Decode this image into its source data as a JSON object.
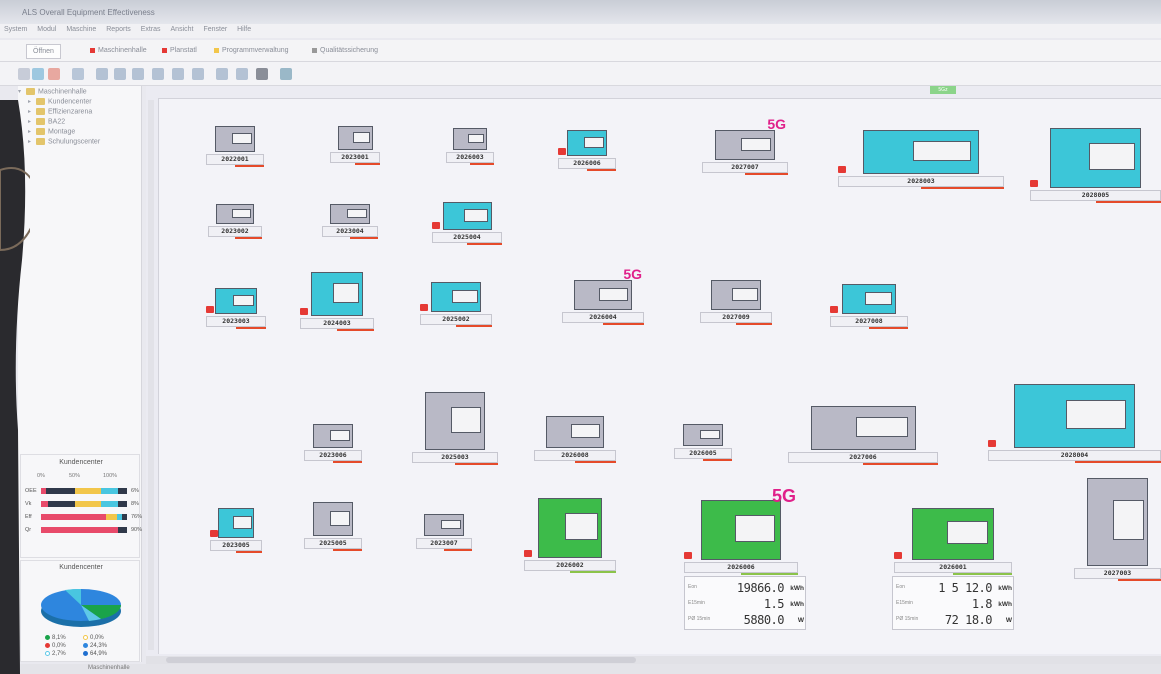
{
  "window": {
    "title": "ALS Overall Equipment Effectiveness"
  },
  "menu": [
    "System",
    "Modul",
    "Maschine",
    "Reports",
    "Extras",
    "Ansicht",
    "Fenster",
    "Hilfe"
  ],
  "tabs": [
    {
      "label": "Öffnen"
    },
    {
      "label": "Maschinenhalle",
      "color": "#e53935"
    },
    {
      "label": "Planstatl",
      "color": "#e53935"
    },
    {
      "label": "Programmverwaltung",
      "color": "#f2c64a"
    },
    {
      "label": "Qualitätssicherung",
      "color": "#999999"
    }
  ],
  "tree": {
    "root": "Maschinenhalle",
    "children": [
      "Kundencenter",
      "Effizienzarena",
      "BA22",
      "Montage",
      "Schulungscenter"
    ]
  },
  "kpi": {
    "title": "Kundencenter",
    "scale": [
      "0%",
      "50%",
      "100%"
    ],
    "rows": [
      {
        "label": "OEE",
        "value": "6%",
        "fill": 0.06
      },
      {
        "label": "Vk",
        "value": "8%",
        "fill": 0.08
      },
      {
        "label": "Eff",
        "value": "76%",
        "fill": 0.76
      },
      {
        "label": "Qr",
        "value": "90%",
        "fill": 0.9
      }
    ]
  },
  "pie": {
    "title": "Kundencenter",
    "legend": [
      {
        "text": "8,1%",
        "color": "#1aa34a"
      },
      {
        "text": "0,0%",
        "color": "#f2c64a"
      },
      {
        "text": "0,0%",
        "color": "#e53935"
      },
      {
        "text": "24,3%",
        "color": "#2e86de"
      },
      {
        "text": "2,7%",
        "color": "#5ec8e8"
      },
      {
        "text": "64,9%",
        "color": "#1f6fd0"
      }
    ]
  },
  "canvas_tag": "5Gz",
  "machines": [
    {
      "id": "2022001",
      "color": "#b9b9c6"
    },
    {
      "id": "2023001",
      "color": "#b9b9c6"
    },
    {
      "id": "2026003",
      "color": "#b9b9c6"
    },
    {
      "id": "2026006",
      "color": "#3cc6d8"
    },
    {
      "id": "2027007",
      "color": "#b9b9c6",
      "badge": "5G"
    },
    {
      "id": "2028003",
      "color": "#3cc6d8"
    },
    {
      "id": "2028005",
      "color": "#3cc6d8"
    },
    {
      "id": "2023002",
      "color": "#b9b9c6"
    },
    {
      "id": "2023004",
      "color": "#b9b9c6"
    },
    {
      "id": "2025004",
      "color": "#3cc6d8"
    },
    {
      "id": "2023003",
      "color": "#3cc6d8"
    },
    {
      "id": "2024003",
      "color": "#3cc6d8"
    },
    {
      "id": "2025002",
      "color": "#3cc6d8"
    },
    {
      "id": "2026004",
      "color": "#b9b9c6",
      "badge": "5G"
    },
    {
      "id": "2027009",
      "color": "#b9b9c6"
    },
    {
      "id": "2027008",
      "color": "#3cc6d8"
    },
    {
      "id": "2023006",
      "color": "#b9b9c6"
    },
    {
      "id": "2025003",
      "color": "#b9b9c6"
    },
    {
      "id": "2026008",
      "color": "#b9b9c6"
    },
    {
      "id": "2026005",
      "color": "#b9b9c6"
    },
    {
      "id": "2027006",
      "color": "#b9b9c6"
    },
    {
      "id": "2028004",
      "color": "#3cc6d8"
    },
    {
      "id": "2023005",
      "color": "#3cc6d8"
    },
    {
      "id": "2025005",
      "color": "#b9b9c6"
    },
    {
      "id": "2023007",
      "color": "#b9b9c6"
    },
    {
      "id": "2026002",
      "color": "#3dbb4a"
    },
    {
      "id": "2026006",
      "color": "#3dbb4a",
      "badge": "5G"
    },
    {
      "id": "2026001",
      "color": "#3dbb4a"
    },
    {
      "id": "2027003",
      "color": "#b9b9c6"
    }
  ],
  "energy": [
    {
      "rows": [
        {
          "label": "Eon",
          "value": "19866.0",
          "unit": "kWh"
        },
        {
          "label": "E15min",
          "value": "1.5",
          "unit": "kWh"
        },
        {
          "label": "PØ 15min",
          "value": "5880.0",
          "unit": "W"
        }
      ]
    },
    {
      "rows": [
        {
          "label": "Eon",
          "value": "1 5 12.0",
          "unit": "kWh"
        },
        {
          "label": "E15min",
          "value": "1.8",
          "unit": "kWh"
        },
        {
          "label": "PØ 15min",
          "value": "72 18.0",
          "unit": "W"
        }
      ]
    }
  ],
  "status": {
    "left": "Maschinenhalle"
  }
}
